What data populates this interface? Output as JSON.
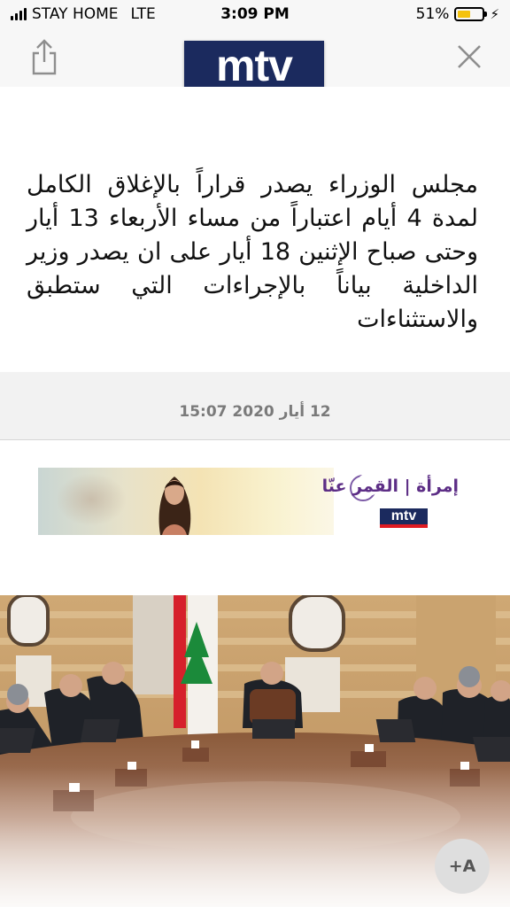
{
  "status_bar": {
    "carrier": "STAY HOME",
    "network": "LTE",
    "time": "3:09 PM",
    "battery_percent": "51%",
    "battery_level": 0.51
  },
  "header": {
    "logo_text": "mtv",
    "share_icon": "share-icon",
    "close_icon": "close-icon"
  },
  "article": {
    "headline": "مجلس الوزراء يصدر قراراً بالإغلاق الكامل لمدة 4 أيام اعتباراً من مساء الأربعاء 13 أيار وحتى صباح الإثنين 18 أيار على ان يصدر وزير الداخلية بياناً بالإجراءات التي ستطبق والاستثناءات",
    "date": "12 أيار 2020 15:07"
  },
  "ad": {
    "title": "إمرأة | القمر عنّا",
    "logo_text": "mtv"
  },
  "controls": {
    "font_size_label": "+A"
  },
  "colors": {
    "brand_navy": "#1b2a5e",
    "brand_red": "#e01b22",
    "ad_purple": "#5d2e86",
    "battery_yellow": "#f4c20d"
  }
}
